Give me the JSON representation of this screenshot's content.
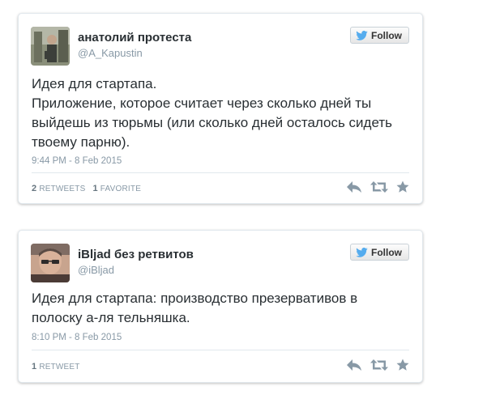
{
  "tweets": [
    {
      "name": "анатолий протеста",
      "handle": "@A_Kapustin",
      "follow_label": "Follow",
      "text_lines": [
        "Идея для стартапа.",
        "Приложение, которое считает через сколько дней ты выйдешь из тюрьмы (или сколько дней осталось сидеть твоему парню)."
      ],
      "time": "9:44 PM - 8 Feb 2015",
      "stats": [
        {
          "count": "2",
          "label": "RETWEETS"
        },
        {
          "count": "1",
          "label": "FAVORITE"
        }
      ]
    },
    {
      "name": "iBljad без ретвитов",
      "handle": "@iBljad",
      "follow_label": "Follow",
      "text_lines": [
        "Идея для стартапа: производство презервативов в полоску а-ля тельняшка."
      ],
      "time": "8:10 PM - 8 Feb 2015",
      "stats": [
        {
          "count": "1",
          "label": "RETWEET"
        }
      ]
    }
  ],
  "icons": {
    "twitter_bird": "twitter-bird-icon",
    "reply": "reply-icon",
    "retweet": "retweet-icon",
    "favorite": "star-icon"
  },
  "colors": {
    "twitter_blue": "#55acee",
    "action_gray": "#8899a6",
    "text": "#292f33",
    "meta": "#8899a6"
  }
}
